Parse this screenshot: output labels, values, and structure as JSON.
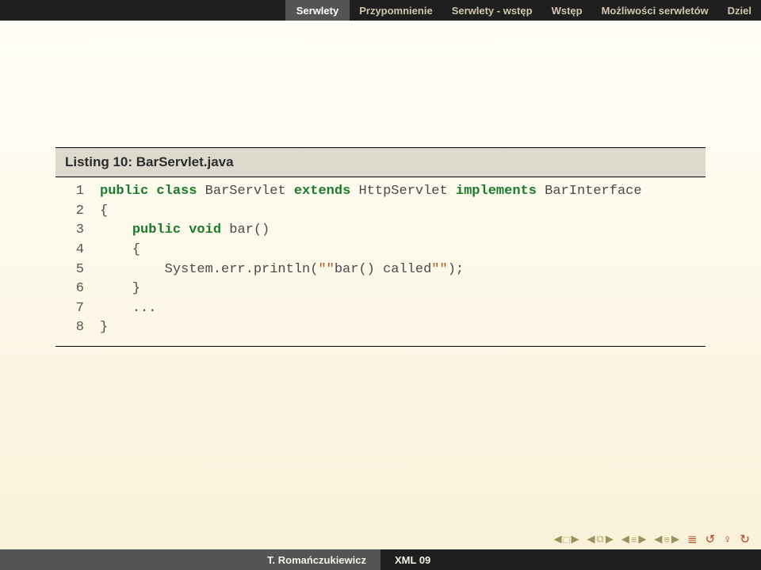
{
  "header": {
    "current": "Serwlety",
    "crumbs": [
      "Przypomnienie",
      "Serwlety - wstęp",
      "Wstęp",
      "Możliwości serwletów",
      "Dziel"
    ]
  },
  "listing": {
    "title": "Listing 10: BarServlet.java"
  },
  "code": {
    "lines": [
      {
        "n": "1",
        "pre": "",
        "tokens": [
          {
            "t": "public",
            "c": "kw"
          },
          {
            "t": " "
          },
          {
            "t": "class",
            "c": "kw"
          },
          {
            "t": " BarServlet "
          },
          {
            "t": "extends",
            "c": "kw"
          },
          {
            "t": " HttpServlet "
          },
          {
            "t": "implements",
            "c": "kw"
          },
          {
            "t": " BarInterface"
          }
        ]
      },
      {
        "n": "2",
        "pre": "",
        "tokens": [
          {
            "t": "{"
          }
        ]
      },
      {
        "n": "3",
        "pre": "    ",
        "tokens": [
          {
            "t": "public",
            "c": "kw"
          },
          {
            "t": " "
          },
          {
            "t": "void",
            "c": "kw"
          },
          {
            "t": " bar()"
          }
        ]
      },
      {
        "n": "4",
        "pre": "    ",
        "tokens": [
          {
            "t": "{"
          }
        ]
      },
      {
        "n": "5",
        "pre": "        ",
        "tokens": [
          {
            "t": "System.err.println("
          },
          {
            "t": "\"\"",
            "c": "str"
          },
          {
            "t": "bar() called"
          },
          {
            "t": "\"\"",
            "c": "str"
          },
          {
            "t": ");"
          }
        ]
      },
      {
        "n": "6",
        "pre": "    ",
        "tokens": [
          {
            "t": "}"
          }
        ]
      },
      {
        "n": "7",
        "pre": "    ",
        "tokens": [
          {
            "t": "..."
          }
        ]
      },
      {
        "n": "8",
        "pre": "",
        "tokens": [
          {
            "t": "}"
          }
        ]
      }
    ]
  },
  "footer": {
    "author": "T. Romańczukiewicz",
    "title": "XML 09"
  }
}
